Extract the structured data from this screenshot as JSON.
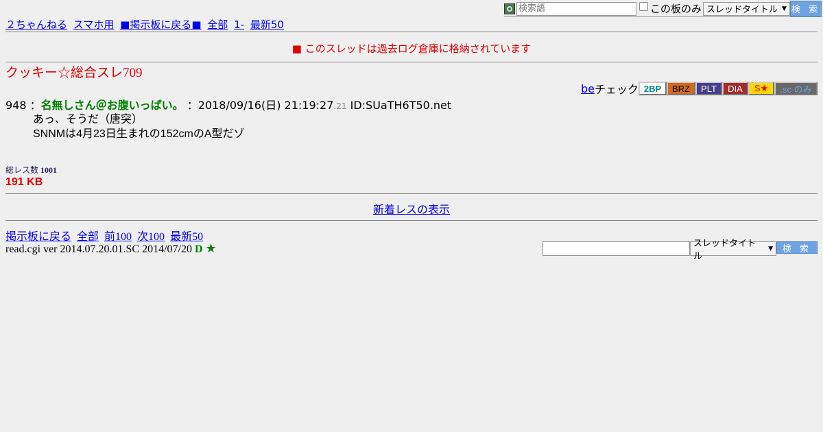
{
  "top_search": {
    "placeholder": "検索語",
    "board_only_label": "この板のみ",
    "select_value": "スレッドタイトル",
    "button_label": "検 索"
  },
  "nav_top": {
    "site": "２ちゃんねる",
    "mobile": "スマホ用",
    "back": "■掲示板に戻る■",
    "all": "全部",
    "from1": "1-",
    "latest50": "最新50"
  },
  "archived_notice": "■ このスレッドは過去ログ倉庫に格納されています",
  "thread_title": "クッキー☆総合スレ709",
  "be_check": {
    "be": "be",
    "check": "チェック",
    "tags": [
      {
        "label": "2BP",
        "bg": "#ffffff",
        "fg": "#008b8b",
        "w": 41
      },
      {
        "label": "BRZ",
        "bg": "#d2691e",
        "fg": "#000000",
        "w": 42
      },
      {
        "label": "PLT",
        "bg": "#483d8b",
        "fg": "#ffffff",
        "w": 39
      },
      {
        "label": "DIA",
        "bg": "#a52a2a",
        "fg": "#ffffff",
        "w": 38
      },
      {
        "label": "S★",
        "bg": "#ffd700",
        "fg": "#e00000",
        "w": 38
      },
      {
        "label": ".sc のみ",
        "bg": "#696969",
        "fg": "#6ea2e0",
        "w": 63
      }
    ]
  },
  "post": {
    "number": "948",
    "separator": "：",
    "name": "名無しさん＠お腹いっぱい。",
    "date": "：2018/09/16(日) 21:19:27",
    "ms": ".21",
    "id": "ID:SUaTH6T50.net",
    "lines": [
      "あっ、そうだ（唐突）",
      "SNNMは4月23日生まれの152cmのA型だゾ"
    ]
  },
  "stats": {
    "count_label": "総レス数",
    "count_value": "1001",
    "size": "191 KB"
  },
  "new_res_label": "新着レスの表示",
  "nav_bottom": {
    "back": "掲示板に戻る",
    "all": "全部",
    "prev": "前100",
    "next": "次100",
    "latest": "最新50"
  },
  "version": {
    "text": "read.cgi ver 2014.07.20.01.SC 2014/07/20",
    "d": "D",
    "star": "★"
  },
  "bottom_search": {
    "value": "",
    "select_value": "スレッドタイトル",
    "button_label": "検 索"
  }
}
